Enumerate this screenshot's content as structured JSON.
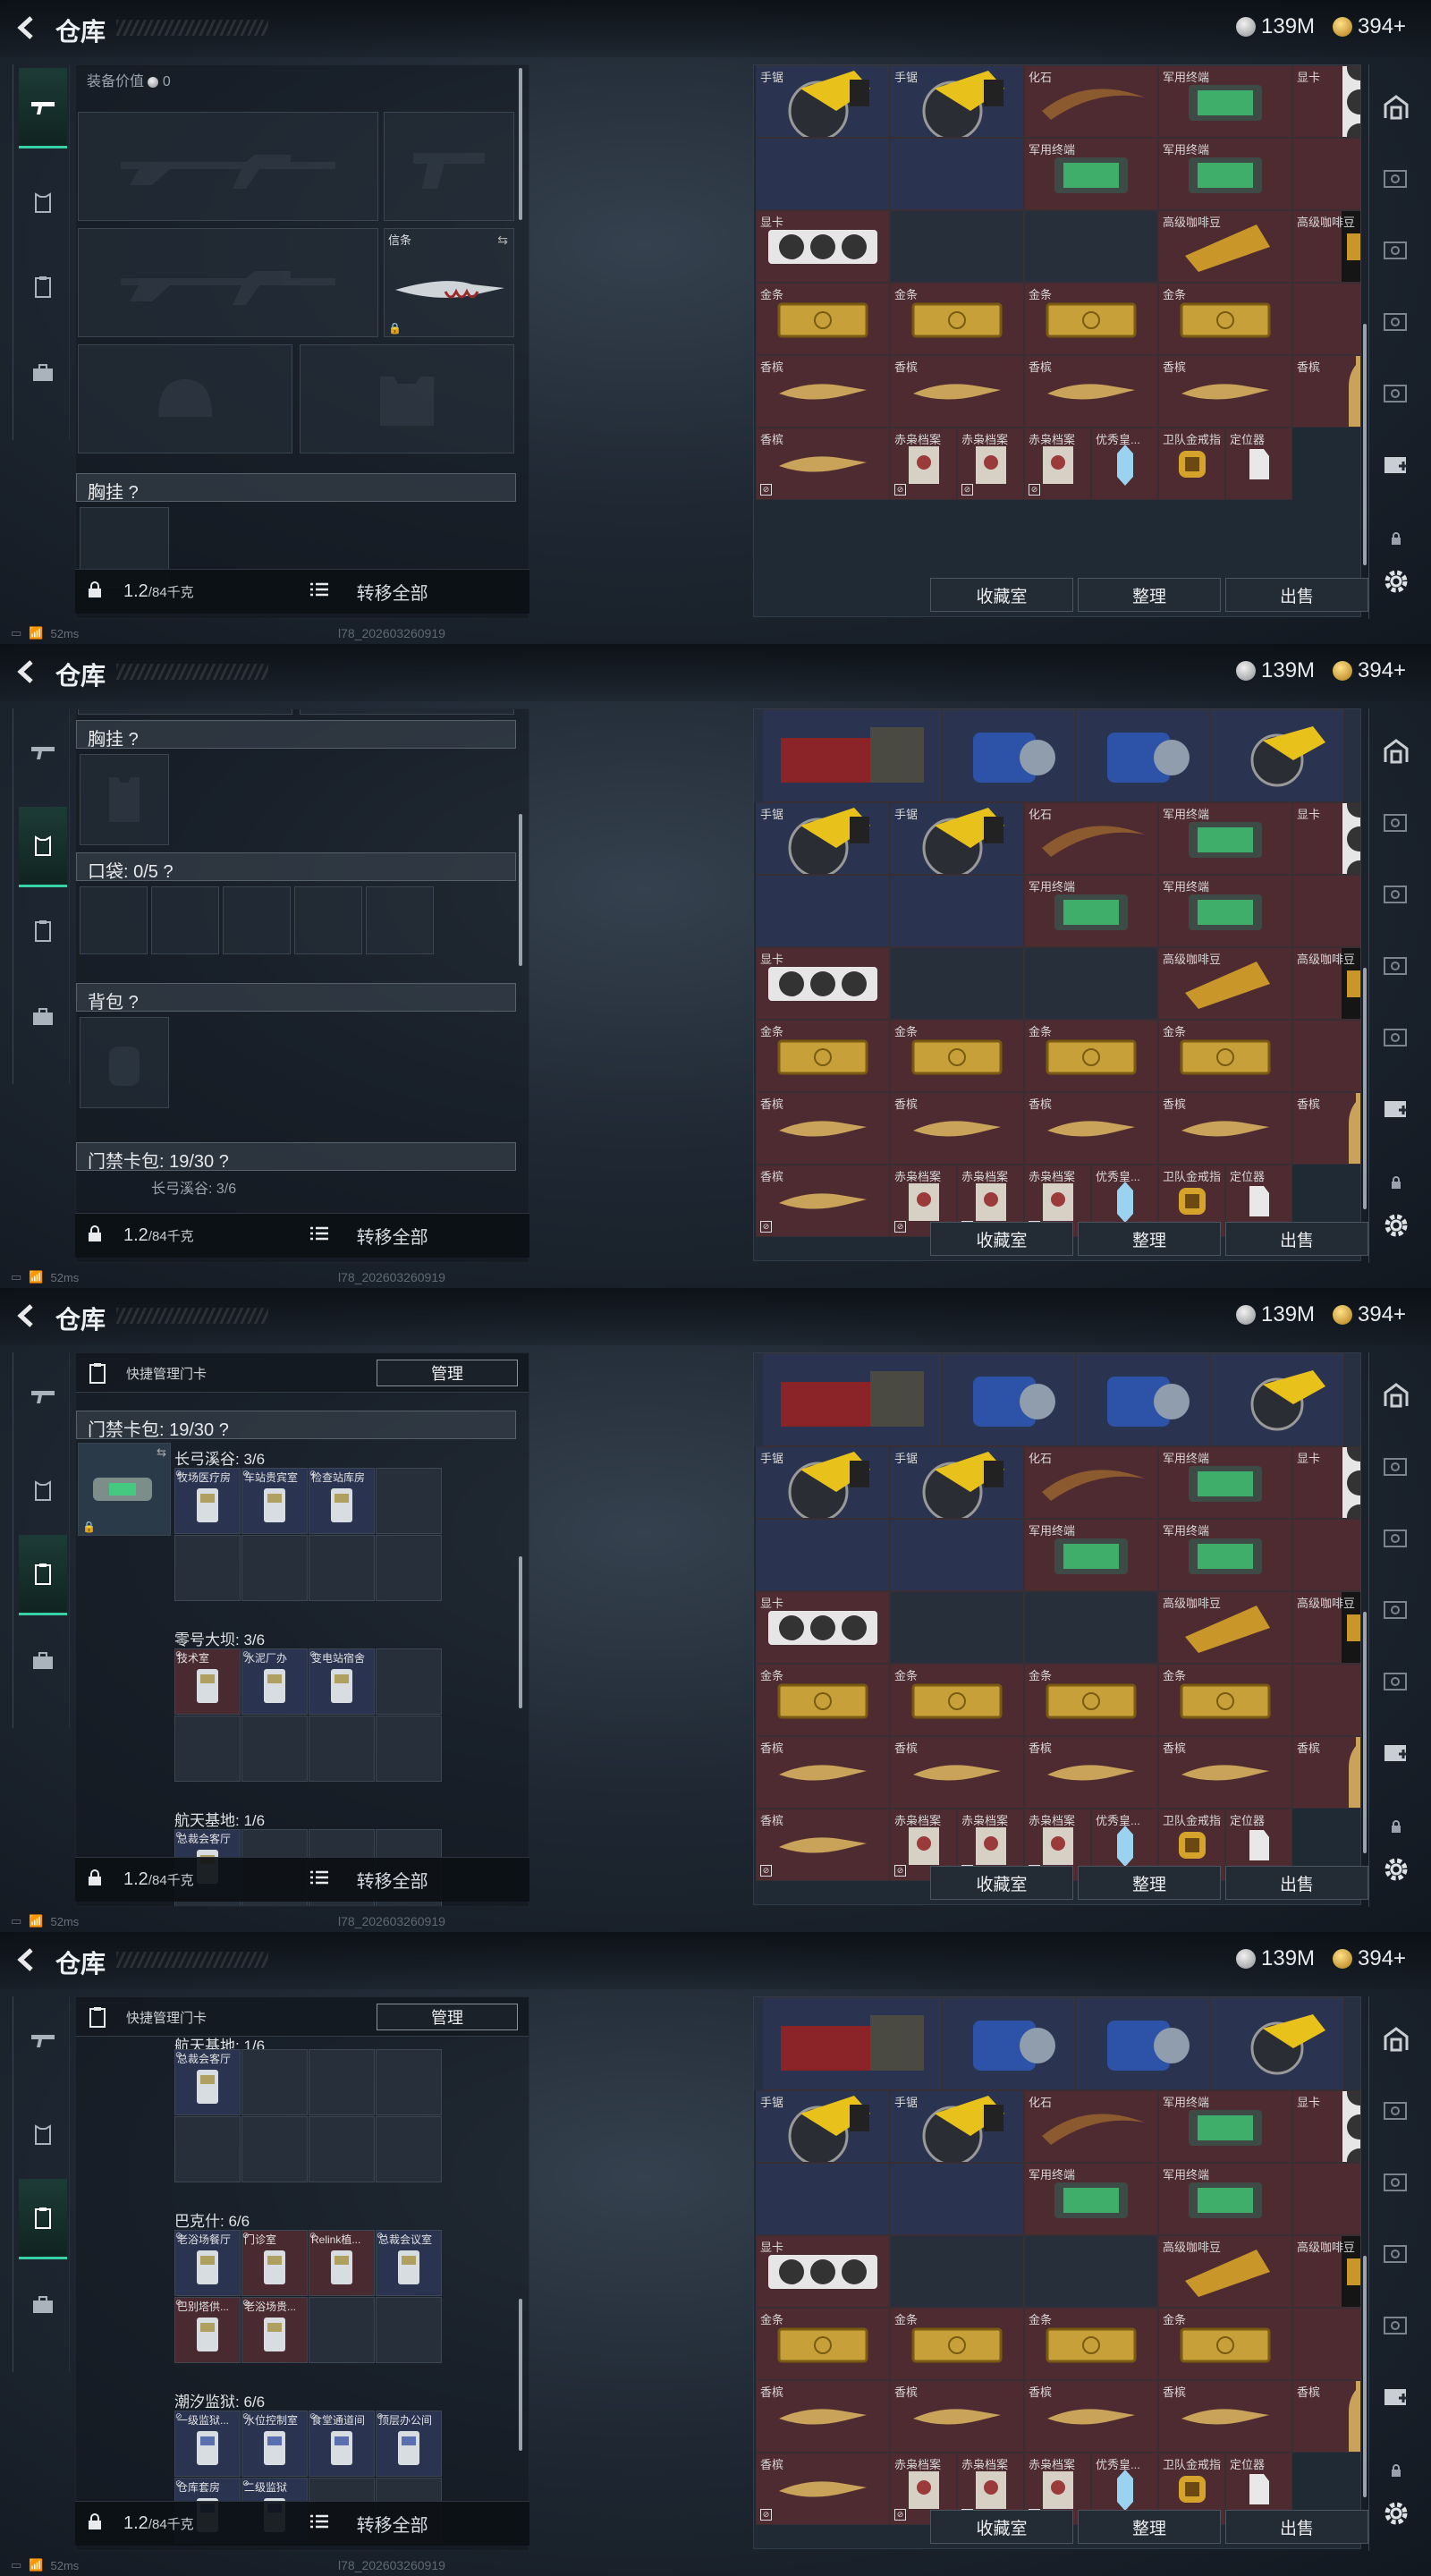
{
  "app": {
    "title": "仓库"
  },
  "currency": {
    "silver": "139M",
    "gold": "394+"
  },
  "status": {
    "ping": "52ms",
    "version": "l78_202603260919"
  },
  "weight": {
    "current": "1.2",
    "capacity": "/84千克"
  },
  "actions": {
    "transfer_all": "转移全部",
    "collection": "收藏室",
    "organize": "整理",
    "sell": "出售"
  },
  "loadout": {
    "equip_value_label": "装备价值",
    "equip_value": "0",
    "rope_label": "信条",
    "chest_rig_label": "胸挂",
    "pockets_label": "口袋: 0/5",
    "backpack_label": "背包",
    "keycard_label": "门禁卡包: 19/30",
    "help_mark": "?",
    "partial_group": "长弓溪谷: 3/6",
    "partial_cut": "...  车站贯穿...  检查站..."
  },
  "keycards": {
    "quick_manage": "快捷管理门卡",
    "manage_button": "管理",
    "groups": [
      {
        "name": "长弓溪谷: 3/6",
        "cards": [
          "牧场医疗房",
          "车站贵宾室",
          "检查站库房"
        ]
      },
      {
        "name": "零号大坝: 3/6",
        "cards": [
          "技术室",
          "水泥厂办",
          "变电站宿舍"
        ]
      },
      {
        "name": "航天基地: 1/6",
        "cards": [
          "总裁会客厅"
        ]
      },
      {
        "name": "巴克什: 6/6",
        "cards": [
          "老浴场餐厅",
          "门诊室",
          "Relink植...",
          "总裁会议室",
          "巴别塔供...",
          "老浴场贵..."
        ]
      },
      {
        "name": "潮汐监狱: 6/6",
        "cards": [
          "一级监狱...",
          "水位控制室",
          "食堂通道间",
          "顶层办公间",
          "仓库套房",
          "二级监狱"
        ]
      }
    ],
    "group_header_cut": "航天基地: 1/6"
  },
  "stash": {
    "rows": [
      [
        {
          "label": "手锯",
          "bg": "blue",
          "icon": "saw"
        },
        {
          "label": "手锯",
          "bg": "blue",
          "icon": "saw"
        },
        {
          "label": "化石",
          "bg": "red",
          "icon": "fossil"
        },
        {
          "label": "军用终端",
          "bg": "red",
          "icon": "terminal"
        },
        {
          "label": "显卡",
          "bg": "red",
          "icon": "gpu-v"
        }
      ],
      [
        {
          "label": "",
          "bg": "blue",
          "icon": "saw-cont"
        },
        {
          "label": "",
          "bg": "blue",
          "icon": "saw-cont"
        },
        {
          "label": "军用终端",
          "bg": "red",
          "icon": "terminal"
        },
        {
          "label": "军用终端",
          "bg": "red",
          "icon": "terminal"
        },
        {
          "label": "",
          "bg": "red",
          "icon": "gpu-cont"
        }
      ],
      [
        {
          "label": "显卡",
          "bg": "red",
          "icon": "gpu-h"
        },
        {
          "label": "",
          "bg": "empty",
          "icon": ""
        },
        {
          "label": "",
          "bg": "empty",
          "icon": ""
        },
        {
          "label": "高级咖啡豆",
          "bg": "red",
          "icon": "coffee"
        },
        {
          "label": "高级咖啡豆",
          "bg": "red",
          "icon": "coffee-bag"
        }
      ],
      [
        {
          "label": "金条",
          "bg": "red",
          "icon": "gold"
        },
        {
          "label": "金条",
          "bg": "red",
          "icon": "gold"
        },
        {
          "label": "金条",
          "bg": "red",
          "icon": "gold"
        },
        {
          "label": "金条",
          "bg": "red",
          "icon": "gold"
        },
        {
          "label": "",
          "bg": "red",
          "icon": ""
        }
      ],
      [
        {
          "label": "香槟",
          "bg": "red",
          "icon": "champ"
        },
        {
          "label": "香槟",
          "bg": "red",
          "icon": "champ"
        },
        {
          "label": "香槟",
          "bg": "red",
          "icon": "champ"
        },
        {
          "label": "香槟",
          "bg": "red",
          "icon": "champ"
        },
        {
          "label": "香槟",
          "bg": "red",
          "icon": "champ-v"
        }
      ],
      [
        {
          "label": "香槟",
          "bg": "red",
          "icon": "champ"
        },
        {
          "label": "赤枭档案",
          "bg": "red",
          "icon": "file"
        },
        {
          "label": "赤枭档案",
          "bg": "red",
          "icon": "file"
        },
        {
          "label": "赤枭档案",
          "bg": "red",
          "icon": "file"
        },
        {
          "label": "优秀皇...",
          "bg": "red",
          "icon": "crystal"
        },
        {
          "label": "卫队金戒指",
          "bg": "red",
          "icon": "ring"
        },
        {
          "label": "定位器",
          "bg": "red",
          "icon": "tracker"
        }
      ]
    ]
  },
  "colors": {
    "accent": "#35d3a6",
    "red_cell": "#4e2a31",
    "blue_cell": "#2a3450"
  }
}
